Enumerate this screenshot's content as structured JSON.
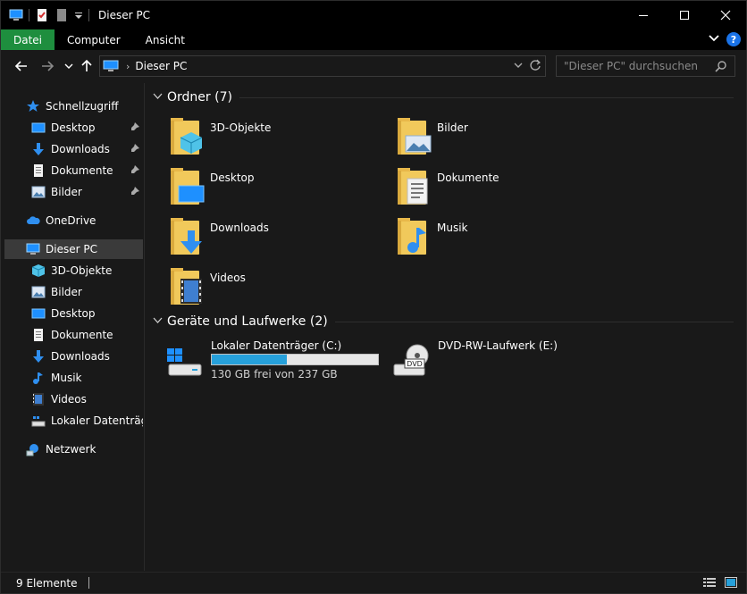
{
  "window": {
    "title": "Dieser PC",
    "controls": {
      "minimize": "—",
      "maximize": "☐",
      "close": "✕"
    }
  },
  "ribbon": {
    "tabs": [
      {
        "label": "Datei",
        "active": true
      },
      {
        "label": "Computer",
        "active": false
      },
      {
        "label": "Ansicht",
        "active": false
      }
    ],
    "help": "?"
  },
  "addressbar": {
    "crumb": "Dieser PC",
    "separator": "›"
  },
  "search": {
    "placeholder": "\"Dieser PC\" durchsuchen"
  },
  "navpane": {
    "quick_access": "Schnellzugriff",
    "quick_items": [
      "Desktop",
      "Downloads",
      "Dokumente",
      "Bilder"
    ],
    "onedrive": "OneDrive",
    "this_pc": "Dieser PC",
    "pc_items": [
      "3D-Objekte",
      "Bilder",
      "Desktop",
      "Dokumente",
      "Downloads",
      "Musik",
      "Videos",
      "Lokaler Datenträger"
    ],
    "network": "Netzwerk"
  },
  "folders_group": {
    "title": "Ordner (7)",
    "items": [
      "3D-Objekte",
      "Bilder",
      "Desktop",
      "Dokumente",
      "Downloads",
      "Musik",
      "Videos"
    ]
  },
  "drives_group": {
    "title": "Geräte und Laufwerke (2)",
    "drives": [
      {
        "label": "Lokaler Datenträger (C:)",
        "free_text": "130 GB frei von 237 GB",
        "used_fraction": 0.45
      },
      {
        "label": "DVD-RW-Laufwerk (E:)"
      }
    ]
  },
  "status": {
    "count": "9 Elemente"
  },
  "colors": {
    "accent_tab": "#1e8e3e",
    "bar_fill": "#26a0da",
    "folder": "#f1c95b"
  }
}
